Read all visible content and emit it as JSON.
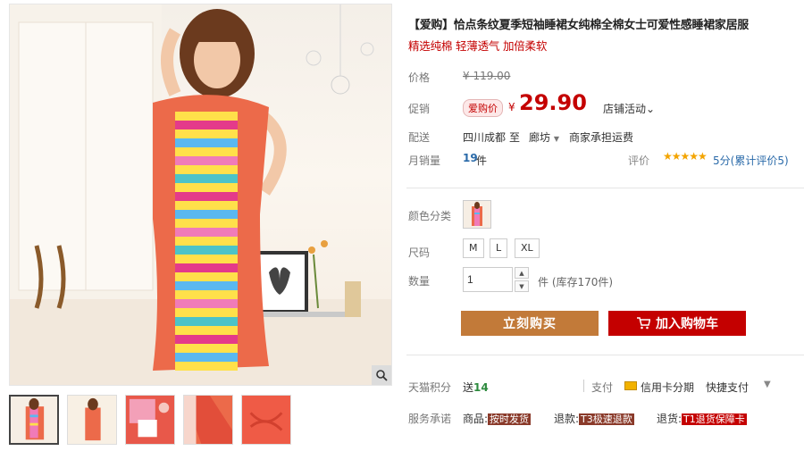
{
  "product": {
    "title": "【爱购】恰点条纹夏季短袖睡裙女纯棉全棉女士可爱性感睡裙家居服",
    "subtitle": "精选纯棉 轻薄透气 加倍柔软"
  },
  "price": {
    "label": "价格",
    "original": "¥ 119.00"
  },
  "promotion": {
    "label": "促销",
    "badge": "爱购价",
    "currency": "¥",
    "price": "29.90",
    "store_activity": "店铺活动"
  },
  "shipping": {
    "label": "配送",
    "from": "四川成都",
    "to_word": "至",
    "destination": "廊坊",
    "fee": "商家承担运费"
  },
  "sales": {
    "label": "月销量",
    "count": "19",
    "unit": "件"
  },
  "rating": {
    "label": "评价",
    "stars": "★★★★★",
    "text": "5分(累计评价5)"
  },
  "options": {
    "color_label": "颜色分类",
    "size_label": "尺码",
    "sizes": [
      "M",
      "L",
      "XL"
    ],
    "quantity_label": "数量",
    "quantity_value": "1",
    "stock_text": "件 (库存170件)"
  },
  "actions": {
    "buy_now": "立刻购买",
    "add_to_cart": "加入购物车"
  },
  "points": {
    "label": "天猫积分",
    "prefix": "送",
    "value": "14"
  },
  "payment": {
    "label": "支付",
    "credit": "信用卡分期",
    "quick": "快捷支付"
  },
  "service": {
    "label": "服务承诺",
    "goods_prefix": "商品:",
    "goods_tag": "按时发货",
    "refund_prefix": "退款:",
    "refund_tag": "T3极速退款",
    "return_prefix": "退货:",
    "return_tag": "T1退货保障卡"
  },
  "colors": {
    "accent": "#c40000",
    "buy_now": "#c27a39",
    "link": "#2a6aa9"
  }
}
